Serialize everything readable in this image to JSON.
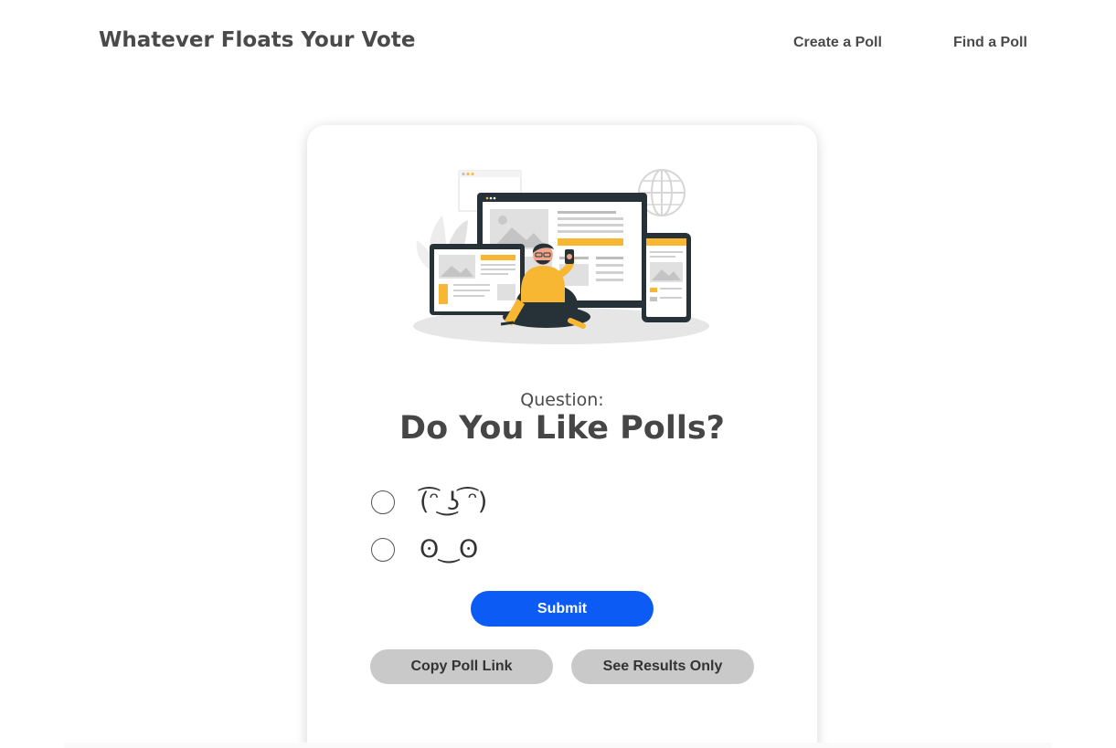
{
  "header": {
    "site_title": "Whatever Floats Your Vote",
    "nav": {
      "create_poll": "Create a Poll",
      "find_poll": "Find a Poll"
    }
  },
  "poll": {
    "question_label": "Question:",
    "question": "Do You Like Polls?",
    "options": [
      {
        "label": "(͡ᵔ ͜ʖ ͡ᵔ)",
        "selected": false
      },
      {
        "label": "ʘ‿ʘ",
        "selected": false
      }
    ],
    "submit_label": "Submit",
    "copy_link_label": "Copy Poll Link",
    "see_results_label": "See Results Only"
  },
  "colors": {
    "primary_button": "#0d5bf5",
    "secondary_button": "#c9c9c9",
    "accent_illustration": "#f7b733",
    "dark_illustration": "#263238"
  },
  "icons": {
    "illustration": "person-with-devices-illustration"
  }
}
